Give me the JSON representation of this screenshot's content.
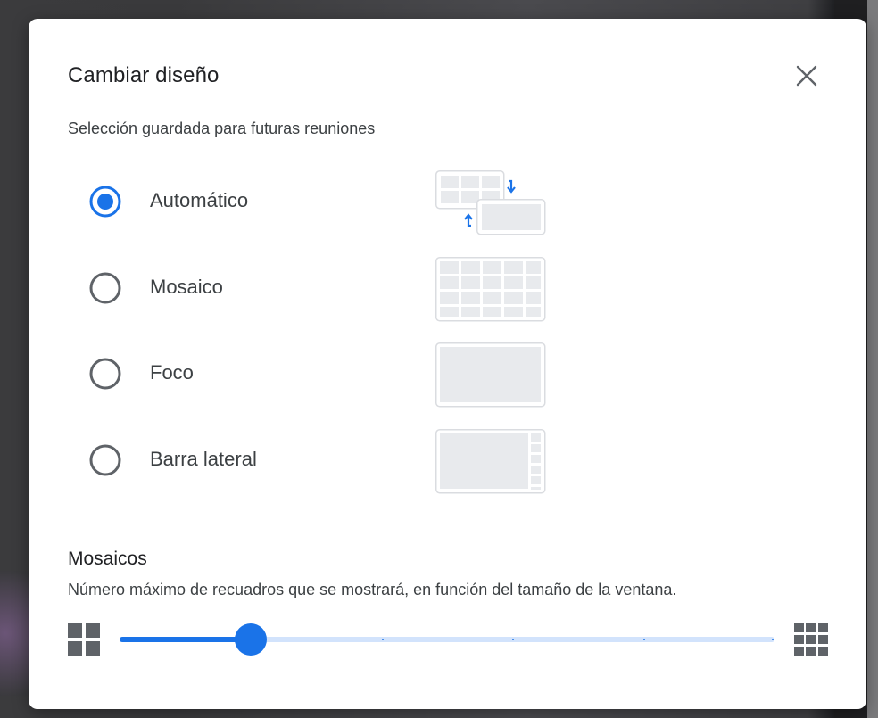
{
  "dialog": {
    "title": "Cambiar diseño",
    "subtitle": "Selección guardada para futuras reuniones"
  },
  "layout_options": [
    {
      "label": "Automático",
      "selected": true,
      "preview_icon": "auto-layout-preview-icon"
    },
    {
      "label": "Mosaico",
      "selected": false,
      "preview_icon": "tiled-layout-preview-icon"
    },
    {
      "label": "Foco",
      "selected": false,
      "preview_icon": "spotlight-layout-preview-icon"
    },
    {
      "label": "Barra lateral",
      "selected": false,
      "preview_icon": "sidebar-layout-preview-icon"
    }
  ],
  "tiles": {
    "title": "Mosaicos",
    "description": "Número máximo de recuadros que se mostrará, en función del tamaño de la ventana.",
    "slider_value_fraction": 0.2,
    "slider_steps": 5,
    "min_icon": "grid-small-icon",
    "max_icon": "grid-large-icon"
  },
  "colors": {
    "accent": "#1a73e8",
    "track": "#d2e3fc",
    "radio_unselected": "#5f6368",
    "preview_fill": "#e8eaed",
    "preview_border": "#dadce0"
  }
}
